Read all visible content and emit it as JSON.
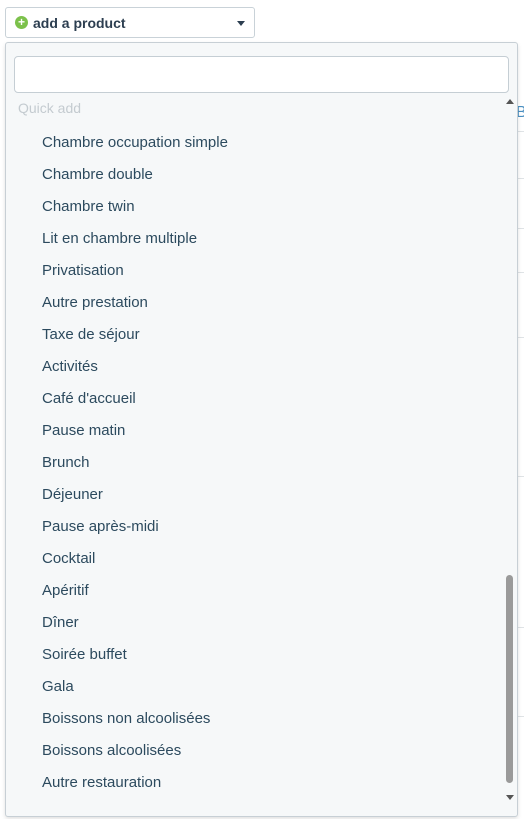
{
  "product_select": {
    "label": "add a product",
    "icon": "plus-circle-icon",
    "caret_icon": "caret-down-icon"
  },
  "dropdown": {
    "search_value": "",
    "group_label": "Quick add",
    "options": [
      "Chambre occupation simple",
      "Chambre double",
      "Chambre twin",
      "Lit en chambre multiple",
      "Privatisation",
      "Autre prestation",
      "Taxe de séjour",
      "Activités",
      "Café d'accueil",
      "Pause matin",
      "Brunch",
      "Déjeuner",
      "Pause après-midi",
      "Cocktail",
      "Apéritif",
      "Dîner",
      "Soirée buffet",
      "Gala",
      "Boissons non alcoolisées",
      "Boissons alcoolisées",
      "Autre restauration"
    ],
    "scroll_position": 0.8
  },
  "background": {
    "partial_letter": "B"
  },
  "colors": {
    "accent_green": "#7cc14b",
    "text": "#2c4a5e",
    "dropdown_bg": "#f6f8f9"
  }
}
